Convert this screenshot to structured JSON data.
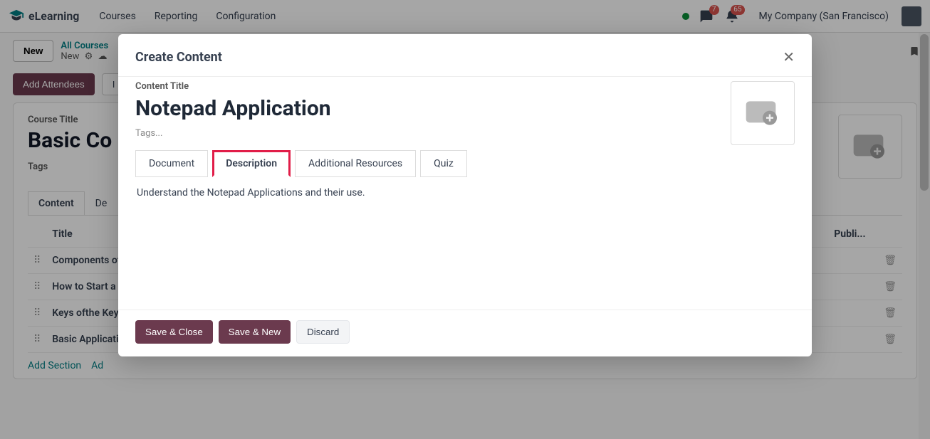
{
  "header": {
    "app_name": "eLearning",
    "nav": [
      "Courses",
      "Reporting",
      "Configuration"
    ],
    "chat_badge": "7",
    "activity_badge": "65",
    "company": "My Company (San Francisco)"
  },
  "breadcrumb": {
    "new_btn": "New",
    "top": "All Courses",
    "bottom": "New"
  },
  "actions": {
    "add_attendees": "Add Attendees",
    "second_btn_partial": "I"
  },
  "course_card": {
    "title_label": "Course Title",
    "title_value": "Basic Co",
    "tags_label": "Tags",
    "tabs": {
      "content": "Content",
      "desc_partial": "De"
    },
    "table": {
      "col_title": "Title",
      "col_unknown": "...",
      "col_publi": "Publi...",
      "rows": [
        "Components of a",
        "How to Start a C",
        "Keys ofthe Keyp",
        "Basic Applicatio"
      ],
      "add_section": "Add Section",
      "add_more_partial": "Ad"
    }
  },
  "modal": {
    "title": "Create Content",
    "content_title_label": "Content Title",
    "content_title_value": "Notepad Application",
    "tags_placeholder": "Tags...",
    "tabs": {
      "document": "Document",
      "description": "Description",
      "additional": "Additional Resources",
      "quiz": "Quiz"
    },
    "description_text": "Understand the Notepad Applications and their use.",
    "footer": {
      "save_close": "Save & Close",
      "save_new": "Save & New",
      "discard": "Discard"
    }
  }
}
